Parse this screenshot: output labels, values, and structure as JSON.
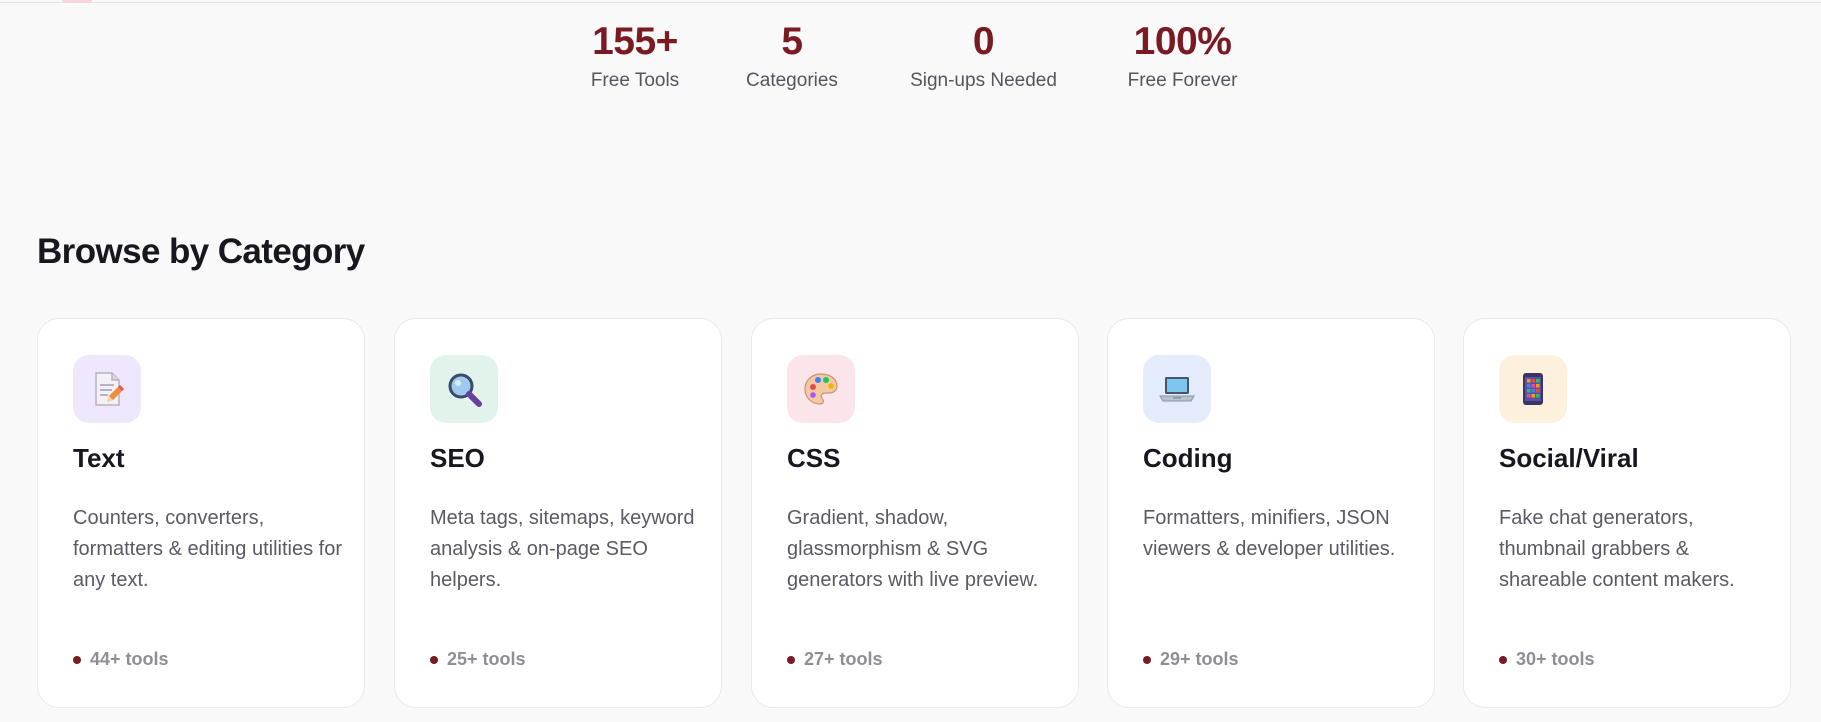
{
  "stats": [
    {
      "value": "155+",
      "label": "Free Tools"
    },
    {
      "value": "5",
      "label": "Categories"
    },
    {
      "value": "0",
      "label": "Sign-ups Needed"
    },
    {
      "value": "100%",
      "label": "Free Forever"
    }
  ],
  "section": {
    "title": "Browse by Category"
  },
  "categories": [
    {
      "icon": "text-document-icon",
      "tile_color": "#efe7fb",
      "title": "Text",
      "description": "Counters, converters, formatters & editing utilities for any text.",
      "count": "44+ tools"
    },
    {
      "icon": "magnifier-icon",
      "tile_color": "#e2f3ec",
      "title": "SEO",
      "description": "Meta tags, sitemaps, keyword analysis & on-page SEO helpers.",
      "count": "25+ tools"
    },
    {
      "icon": "palette-icon",
      "tile_color": "#fce5ea",
      "title": "CSS",
      "description": "Gradient, shadow, glassmorphism & SVG generators with live preview.",
      "count": "27+ tools"
    },
    {
      "icon": "laptop-icon",
      "tile_color": "#e4ecfb",
      "title": "Coding",
      "description": "Formatters, minifiers, JSON viewers & developer utilities.",
      "count": "29+ tools"
    },
    {
      "icon": "mobile-phone-icon",
      "tile_color": "#fdf0dc",
      "title": "Social/Viral",
      "description": "Fake chat generators, thumbnail grabbers & shareable content makers.",
      "count": "30+ tools"
    }
  ],
  "colors": {
    "accent": "#7a1a22",
    "background": "#f9f9f9"
  }
}
